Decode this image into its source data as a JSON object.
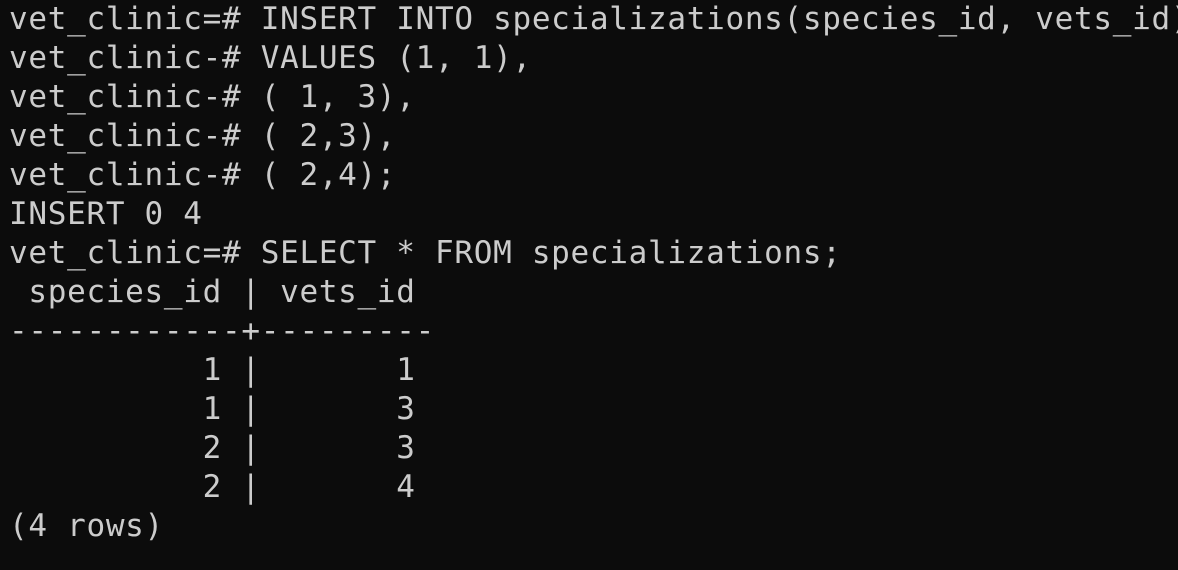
{
  "terminal": {
    "lines": [
      "vet_clinic=# INSERT INTO specializations(species_id, vets_id)",
      "vet_clinic-# VALUES (1, 1),",
      "vet_clinic-# ( 1, 3),",
      "vet_clinic-# ( 2,3),",
      "vet_clinic-# ( 2,4);",
      "INSERT 0 4",
      "vet_clinic=# SELECT * FROM specializations;",
      " species_id | vets_id",
      "------------+---------",
      "          1 |       1",
      "          1 |       3",
      "          2 |       3",
      "          2 |       4",
      "(4 rows)"
    ]
  },
  "colors": {
    "background": "#0c0c0c",
    "foreground": "#cccccc"
  }
}
